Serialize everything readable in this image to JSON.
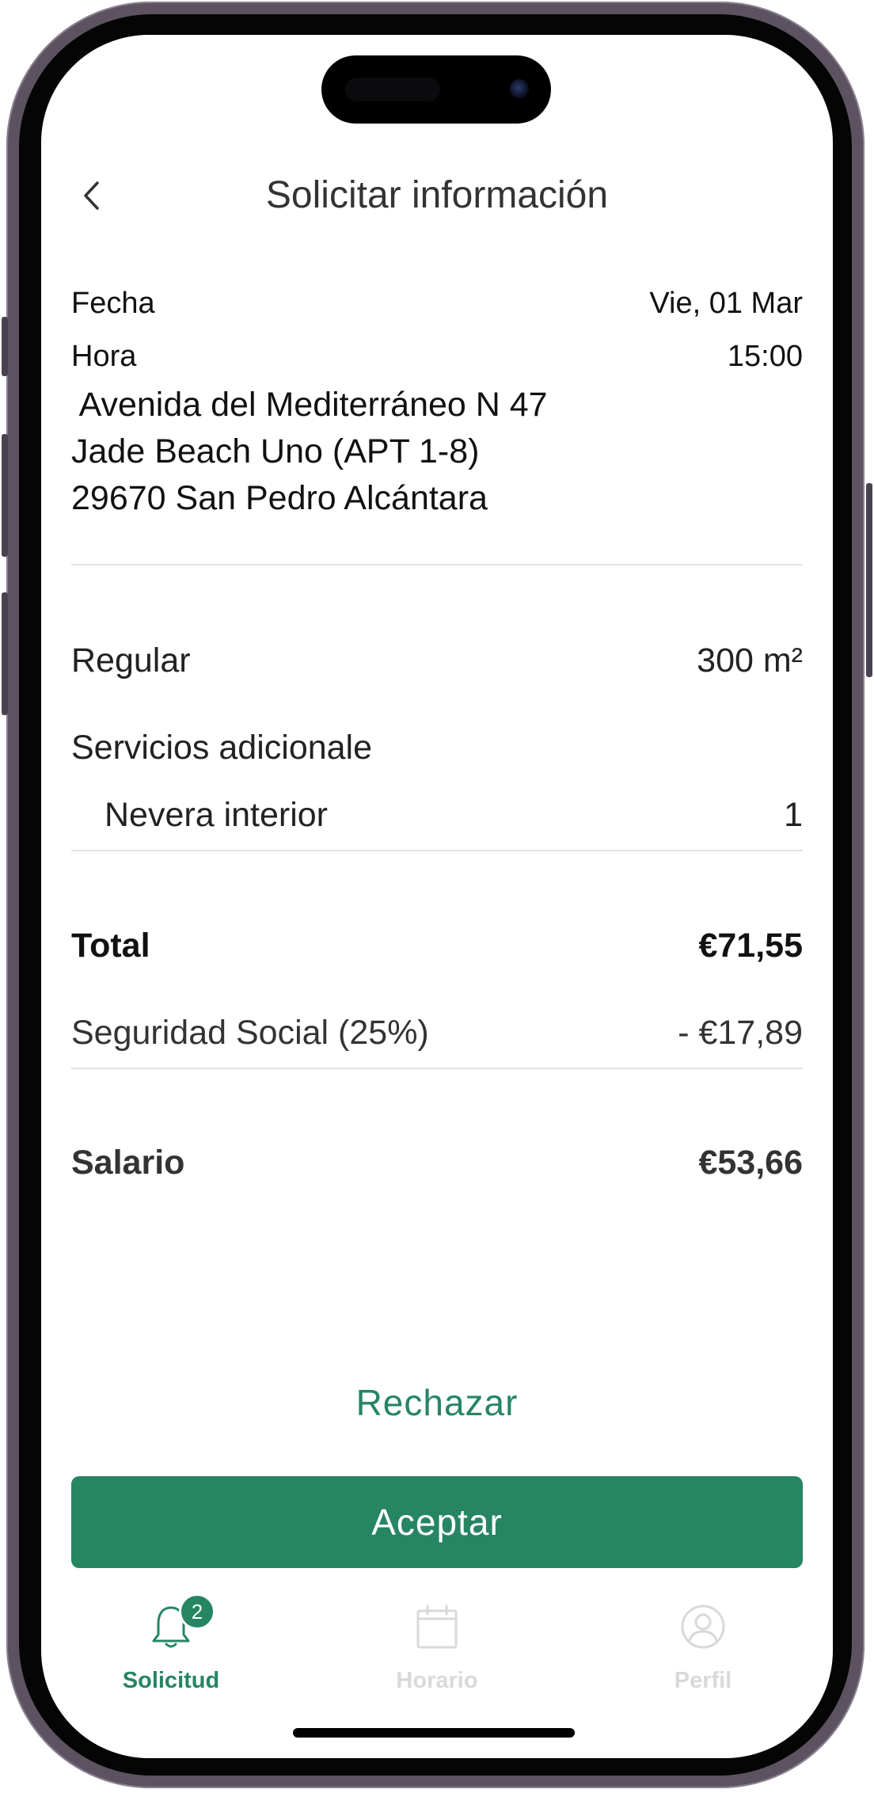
{
  "header": {
    "title": "Solicitar información",
    "back_icon": "chevron-left-icon"
  },
  "details": {
    "date_label": "Fecha",
    "date_value": "Vie, 01 Mar",
    "time_label": "Hora",
    "time_value": "15:00",
    "address": " Avenida del Mediterráneo N 47\nJade Beach Uno (APT 1-8)\n29670 San Pedro Alcántara"
  },
  "service": {
    "type_label": "Regular",
    "type_value": "300 m²",
    "extras_label": "Servicios adicionale",
    "extras": [
      {
        "name": "Nevera interior",
        "qty": "1"
      }
    ]
  },
  "summary": {
    "total_label": "Total",
    "total_value": "€71,55",
    "ss_label": "Seguridad Social (25%)",
    "ss_value": "- €17,89",
    "salary_label": "Salario",
    "salary_value": "€53,66"
  },
  "actions": {
    "reject_label": "Rechazar",
    "accept_label": "Aceptar"
  },
  "tabbar": {
    "tabs": [
      {
        "label": "Solicitud",
        "icon": "bell-icon",
        "badge": "2",
        "active": true
      },
      {
        "label": "Horario",
        "icon": "calendar-icon",
        "active": false
      },
      {
        "label": "Perfil",
        "icon": "user-profile-icon",
        "active": false
      }
    ]
  },
  "colors": {
    "accent": "#268562",
    "inactive_tab": "#d9d9d9",
    "divider": "#e3e3e3"
  }
}
